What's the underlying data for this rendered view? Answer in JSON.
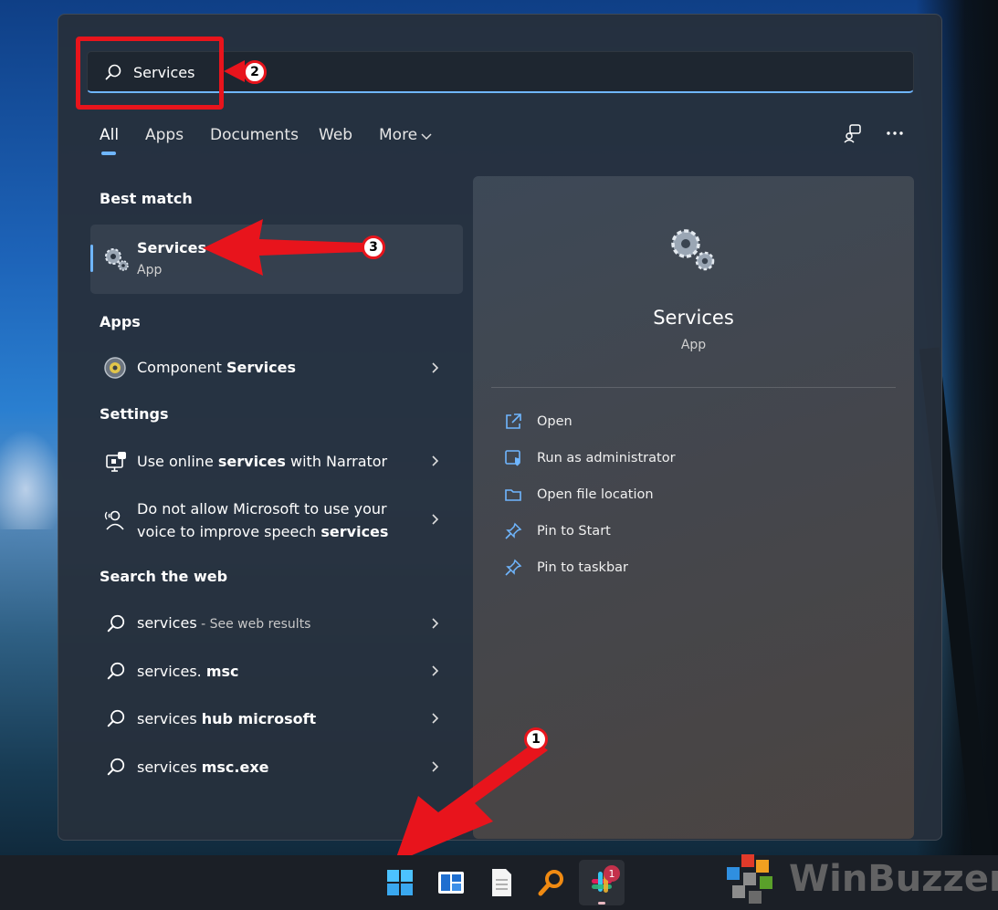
{
  "search": {
    "value": "Services"
  },
  "tabs": [
    {
      "label": "All",
      "active": true
    },
    {
      "label": "Apps"
    },
    {
      "label": "Documents"
    },
    {
      "label": "Web"
    },
    {
      "label": "More"
    }
  ],
  "toolbar": {
    "account_icon": "account-switch-icon",
    "more_icon": "ellipsis-icon"
  },
  "best_match": {
    "heading": "Best match",
    "title": "Services",
    "subtitle": "App"
  },
  "apps": {
    "heading": "Apps",
    "items": [
      {
        "prefix": "Component ",
        "bold": "Services"
      }
    ]
  },
  "settings": {
    "heading": "Settings",
    "items": [
      {
        "line1_pre": "Use online ",
        "line1_bold": "services",
        "line1_post": " with Narrator"
      },
      {
        "line1": "Do not allow Microsoft to use your",
        "line2_pre": "voice to improve speech ",
        "line2_bold": "services"
      }
    ]
  },
  "web": {
    "heading": "Search the web",
    "items": [
      {
        "pre": "services",
        "bold": "",
        "suffix": " - See web results"
      },
      {
        "pre": "services. ",
        "bold": "msc",
        "suffix": ""
      },
      {
        "pre": "services ",
        "bold": "hub microsoft",
        "suffix": ""
      },
      {
        "pre": "services ",
        "bold": "msc.exe",
        "suffix": ""
      }
    ]
  },
  "preview": {
    "title": "Services",
    "subtitle": "App",
    "actions": [
      {
        "label": "Open",
        "icon": "open-external-icon"
      },
      {
        "label": "Run as administrator",
        "icon": "shield-icon"
      },
      {
        "label": "Open file location",
        "icon": "folder-icon"
      },
      {
        "label": "Pin to Start",
        "icon": "pin-icon"
      },
      {
        "label": "Pin to taskbar",
        "icon": "pin-icon"
      }
    ]
  },
  "callouts": {
    "c1": "1",
    "c2": "2",
    "c3": "3"
  },
  "taskbar": {
    "slack_badge": "1"
  },
  "watermark": {
    "text": "WinBuzzer"
  },
  "colors": {
    "accent": "#6fb6ff",
    "annotation_red": "#e8141c"
  }
}
